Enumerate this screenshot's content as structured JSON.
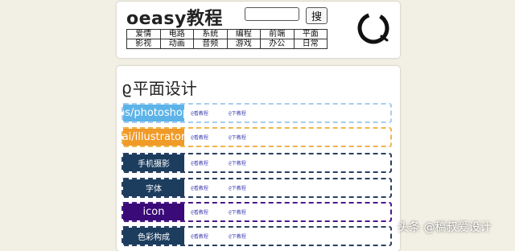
{
  "header": {
    "logo": "oeasy教程",
    "search_placeholder": "",
    "search_button": "搜",
    "nav_rows": [
      [
        "爱情",
        "电路",
        "系统",
        "编程",
        "前端",
        "平面"
      ],
      [
        "影视",
        "动画",
        "音频",
        "游戏",
        "办公",
        "日常"
      ]
    ]
  },
  "section": {
    "icon": "spiral-icon",
    "title": "平面设计",
    "rows": [
      {
        "label": "ps/photoshop",
        "color": "#5bb3e8",
        "border": "#a8ccef",
        "view": "看教程",
        "download": "下教程"
      },
      {
        "label": "ai/illustrator",
        "color": "#f09a28",
        "border": "#f0b54c",
        "view": "看教程",
        "download": "下教程"
      },
      {
        "label": "手机摄影",
        "color": "#1c3d5e",
        "border": "#2a3f63",
        "view": "看教程",
        "download": "下教程"
      },
      {
        "label": "字体",
        "color": "#1c3d5e",
        "border": "#2a3f63",
        "view": "看教程",
        "download": "下教程"
      },
      {
        "label": "icon",
        "color": "#3a0a78",
        "border": "#4a1a88",
        "view": "看教程",
        "download": "下教程"
      },
      {
        "label": "色彩构成",
        "color": "#1c3d5e",
        "border": "#2a3f63",
        "view": "看教程",
        "download": "下教程"
      }
    ]
  },
  "watermark": "头条 @稿叔爱设计"
}
